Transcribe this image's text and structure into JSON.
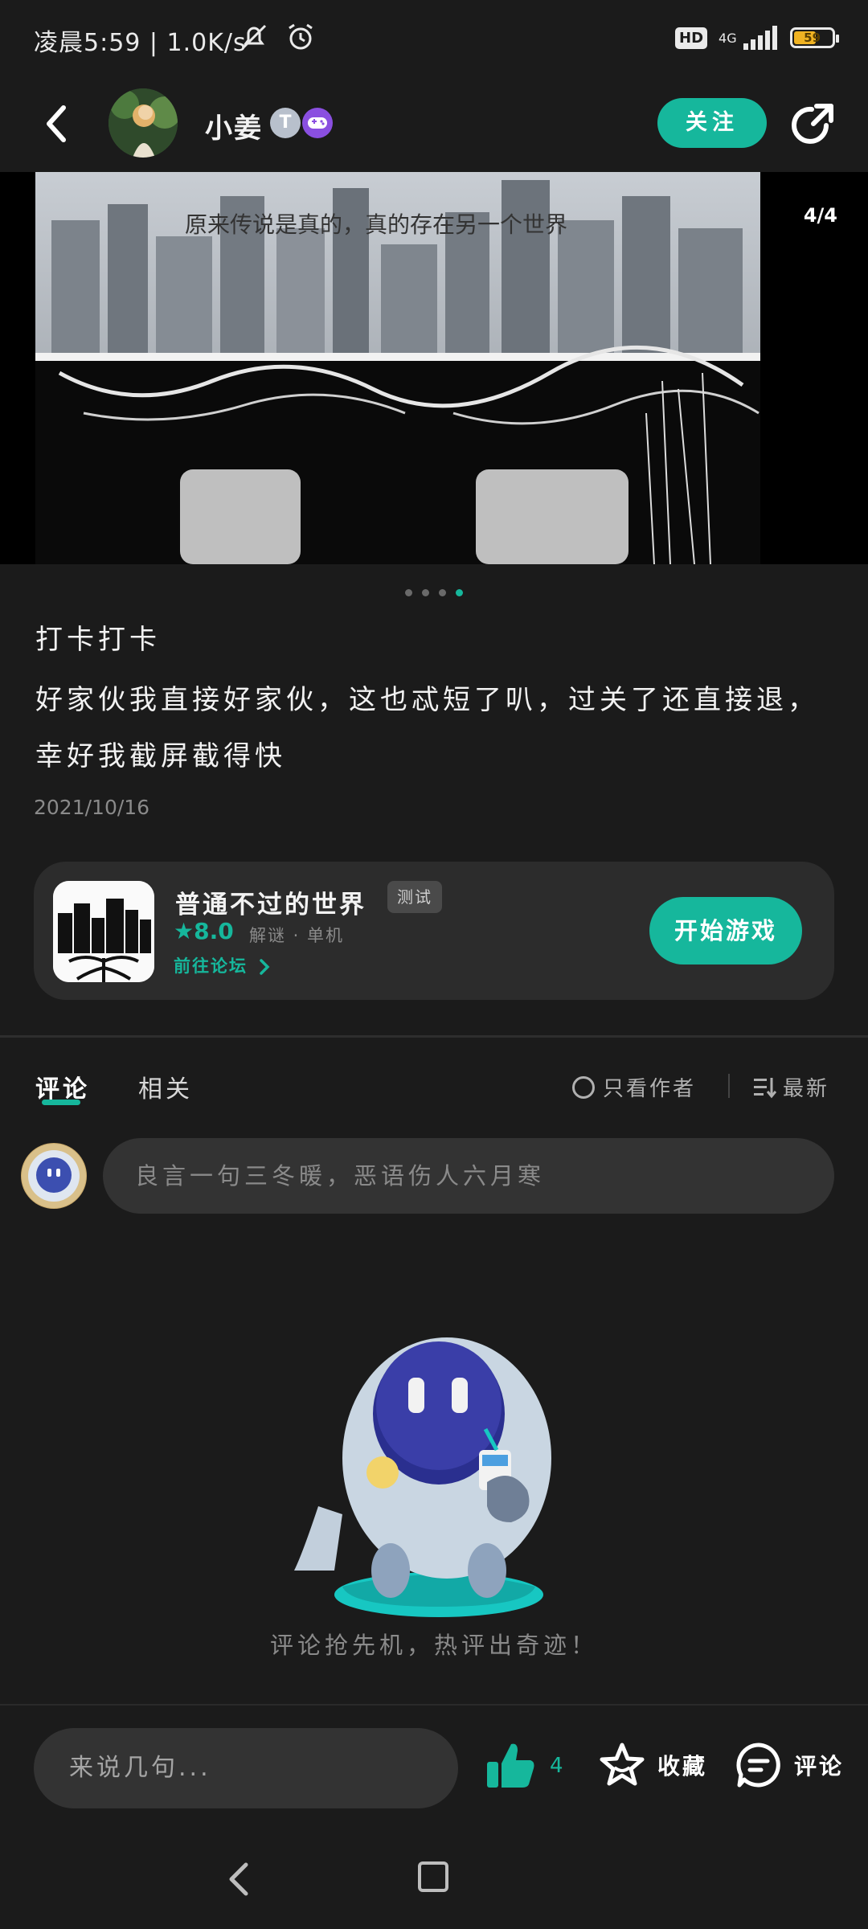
{
  "status_bar": {
    "time_text": "凌晨5:59 | 1.0K/s",
    "hd_label": "HD",
    "network_label": "4G",
    "battery_level": "59",
    "battery_fraction": 0.59
  },
  "header": {
    "username": "小姜",
    "badge_letter": "T",
    "follow_label": "关注"
  },
  "banner": {
    "counter": "4/4",
    "caption": "原来传说是真的，真的存在另一个世界",
    "page_count": 4,
    "active_page": 4
  },
  "post": {
    "title": "打卡打卡",
    "body": "好家伙我直接好家伙，这也忒短了叭，过关了还直接退，幸好我截屏截得快",
    "date": "2021/10/16"
  },
  "game": {
    "name": "普通不过的世界",
    "tag": "测试",
    "rating": "8.0",
    "genre": "解谜 · 单机",
    "forum_link": "前往论坛",
    "play_label": "开始游戏"
  },
  "tabs": {
    "comments": "评论",
    "related": "相关",
    "author_only": "只看作者",
    "sort": "最新"
  },
  "comment_box": {
    "placeholder": "良言一句三冬暖，恶语伤人六月寒"
  },
  "empty_state": {
    "text": "评论抢先机，热评出奇迹！"
  },
  "bottom_bar": {
    "input_placeholder": "来说几句...",
    "like_count": "4",
    "favorite_label": "收藏",
    "comment_label": "评论"
  },
  "colors": {
    "accent": "#16b79c",
    "background": "#1b1b1b",
    "card": "#2c2c2c",
    "battery": "#f0b323"
  }
}
